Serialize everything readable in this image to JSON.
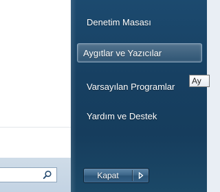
{
  "start_menu": {
    "search": {
      "value": "",
      "icon": "search-icon"
    },
    "right_items": [
      {
        "label": "Denetim Masası"
      },
      {
        "label": "Aygıtlar ve Yazıcılar"
      },
      {
        "label": "Varsayılan Programlar"
      },
      {
        "label": "Yardım ve Destek"
      }
    ],
    "tooltip": "Ay",
    "shutdown": {
      "label": "Kapat",
      "arrow_icon": "arrow-right-icon"
    }
  }
}
